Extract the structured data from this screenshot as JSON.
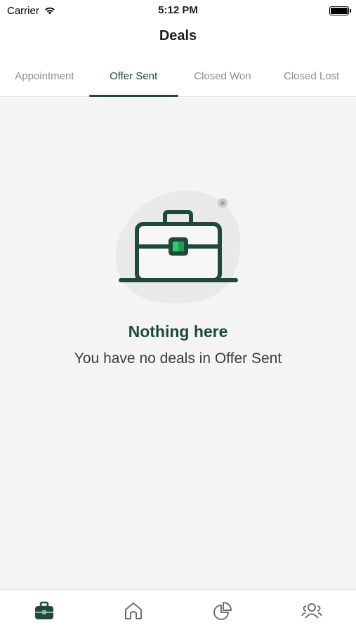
{
  "status": {
    "carrier": "Carrier",
    "time": "5:12 PM"
  },
  "header": {
    "title": "Deals"
  },
  "tabs": [
    {
      "label": "Appointment",
      "active": false
    },
    {
      "label": "Offer Sent",
      "active": true
    },
    {
      "label": "Closed Won",
      "active": false
    },
    {
      "label": "Closed Lost",
      "active": false
    }
  ],
  "empty_state": {
    "title": "Nothing here",
    "message": "You have no deals in Offer Sent",
    "icon": "briefcase-icon"
  },
  "bottom_nav": [
    {
      "icon": "briefcase-icon",
      "active": true
    },
    {
      "icon": "home-icon",
      "active": false
    },
    {
      "icon": "pie-chart-icon",
      "active": false
    },
    {
      "icon": "users-icon",
      "active": false
    }
  ],
  "colors": {
    "primary": "#1f4a3a",
    "accent": "#2ecc71",
    "background": "#f4f4f5",
    "muted": "#8a8f93"
  }
}
